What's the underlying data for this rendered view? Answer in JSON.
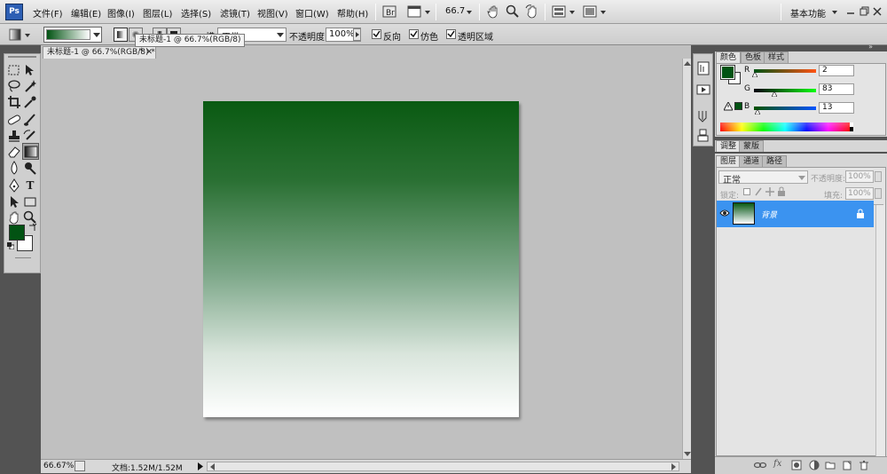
{
  "app": {
    "logo": "Ps",
    "workspace_label": "基本功能"
  },
  "menu": [
    "文件(F)",
    "编辑(E)",
    "图像(I)",
    "图层(L)",
    "选择(S)",
    "滤镜(T)",
    "视图(V)",
    "窗口(W)",
    "帮助(H)"
  ],
  "menubar": {
    "zoom": "66.7"
  },
  "options_bar": {
    "mode_label": "模式:",
    "mode_value": "正常",
    "opacity_label": "不透明度:",
    "opacity_value": "100%",
    "reverse_label": "反向",
    "dither_label": "仿色",
    "transparency_label": "透明区域"
  },
  "document": {
    "tab_title": "未标题-1 @ 66.7%(RGB/8) *",
    "tooltip": "未标题-1 @ 66.7%(RGB/8) *",
    "zoom_status": "66.67%",
    "doc_info": "文档:1.52M/1.52M"
  },
  "colors": {
    "foreground": "#025313",
    "background": "#ffffff",
    "gradient_top": "#0a5a12",
    "gradient_bottom": "#ffffff",
    "selection": "#3b93f0"
  },
  "color_panel": {
    "tabs": [
      "颜色",
      "色板",
      "样式"
    ],
    "r_label": "R",
    "r_value": "2",
    "g_label": "G",
    "g_value": "83",
    "b_label": "B",
    "b_value": "13"
  },
  "adjust_panel": {
    "tabs": [
      "调整",
      "蒙版"
    ]
  },
  "layers_panel": {
    "tabs": [
      "图层",
      "通道",
      "路径"
    ],
    "blend_mode": "正常",
    "opacity_label": "不透明度:",
    "opacity_value": "100%",
    "lock_label": "锁定:",
    "fill_label": "填充:",
    "fill_value": "100%",
    "layers": [
      {
        "name": "背景",
        "locked": true,
        "visible": true
      }
    ]
  },
  "icons": [
    "marquee-icon",
    "move-icon",
    "lasso-icon",
    "magic-wand-icon",
    "crop-icon",
    "eyedropper-icon",
    "healing-icon",
    "brush-icon",
    "stamp-icon",
    "history-brush-icon",
    "eraser-icon",
    "gradient-icon",
    "blur-icon",
    "dodge-icon",
    "pen-icon",
    "type-icon",
    "path-select-icon",
    "shape-icon",
    "hand-icon",
    "zoom-icon"
  ]
}
